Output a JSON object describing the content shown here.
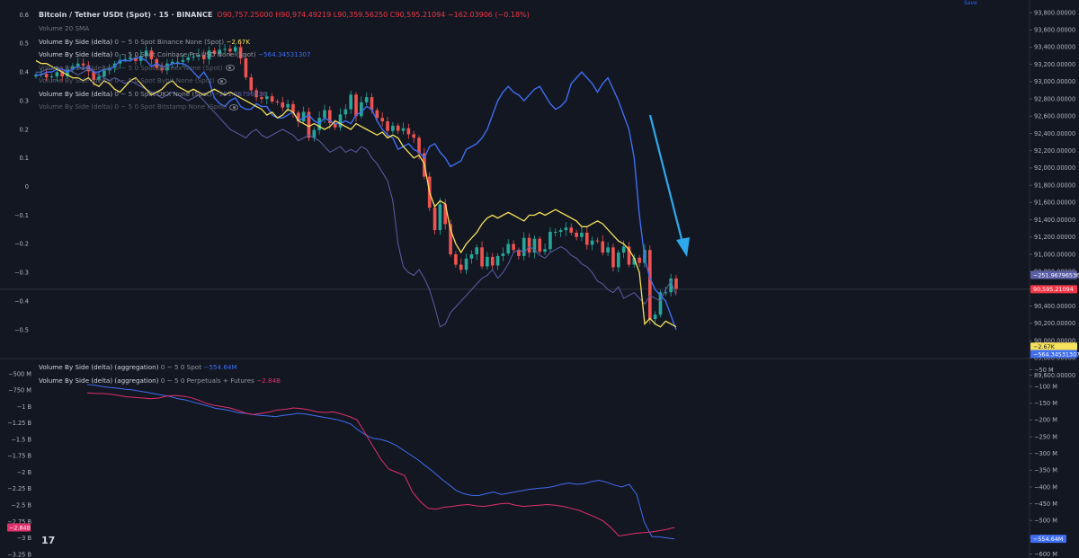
{
  "header": {
    "symbol": "Bitcoin / Tether USDt (Spot) · 15 · BINANCE",
    "ohlc": {
      "o_label": "O",
      "o": "90,757.25000",
      "h_label": "H",
      "h": "90,974.49219",
      "l_label": "L",
      "l": "90,359.56250",
      "c_label": "C",
      "c": "90,595.21094",
      "change": "−162.03906 (−0.18%)"
    },
    "top_right_tag": "Save"
  },
  "legend_top": [
    {
      "name": "Volume 20 SMA",
      "params": "",
      "value": "",
      "value_color": "#6f7482"
    },
    {
      "name": "Volume By Side (delta)",
      "params": "0 ∼ 5 0 Spot Binance None (Spot)",
      "value": "−2.67K",
      "value_color": "#f5e15b"
    },
    {
      "name": "Volume By Side (delta)",
      "params": "0 ∼ 5 0 Spot Coinbase Pro USD None (Spot)",
      "value": "−564.34531307",
      "value_color": "#3f6df0"
    },
    {
      "name": "Volume By Side (delta)",
      "params": "0 ∼ 5 0 Spot Bitfinex None (Spot)",
      "value": "",
      "value_color": "#6f7482"
    },
    {
      "name": "Volume By Side (delta)",
      "params": "0 ∼ 5 0 Spot Bybit None (Spot)",
      "value": "",
      "value_color": "#6f7482"
    },
    {
      "name": "Volume By Side (delta)",
      "params": "0 ∼ 5 0 Spot OKX None (Spot)",
      "value": "−251.96796536",
      "value_color": "#5a5fa8"
    },
    {
      "name": "Volume By Side (delta)",
      "params": "0 ∼ 5 0 Spot Bitstamp None (Spot)",
      "value": "",
      "value_color": "#6f7482"
    }
  ],
  "legend_bottom": [
    {
      "name": "Volume By Side (delta) (aggregation)",
      "params": "0 ∼ 5 0 Spot",
      "value": "−554.64M",
      "value_color": "#3f6df0"
    },
    {
      "name": "Volume By Side (delta) (aggregation)",
      "params": "0 ∼ 5 0 Perpetuals + Futures",
      "value": "−2.84B",
      "value_color": "#e0306a"
    }
  ],
  "colors": {
    "background": "#131722",
    "up": "#26a69a",
    "down": "#ef5350",
    "binance": "#f5e15b",
    "coinbase": "#3f6df0",
    "okx": "#5a5fa8",
    "spot_agg": "#3f6df0",
    "perp_agg": "#e0306a",
    "arrow": "#2fa8ee"
  },
  "price_tags": [
    {
      "text": "−251.96796536",
      "bg": "#5a5fa8",
      "fg": "#ffffff",
      "value": 90760
    },
    {
      "text": "90,595.21094",
      "bg": "#f23645",
      "fg": "#ffffff",
      "value": 90595
    },
    {
      "text": "−2.67K",
      "bg": "#f5e15b",
      "fg": "#131722",
      "value": 89930
    },
    {
      "text": "−564.34531307",
      "bg": "#3f6df0",
      "fg": "#ffffff",
      "value": 89845
    }
  ],
  "bottom_tags": {
    "left": {
      "text": "−2.84B",
      "bg": "#e0306a",
      "fg": "#ffffff",
      "value": -2.84
    },
    "right": {
      "text": "−554.64M",
      "bg": "#3f6df0",
      "fg": "#ffffff",
      "value": -554.64
    }
  },
  "tv_logo": "17",
  "chart_data": [
    {
      "type": "candlestick",
      "title": "Bitcoin / Tether USDt (Spot) · 15 · BINANCE",
      "right_axis": {
        "ticks": [
          "93,800.00000",
          "93,600.00000",
          "93,400.00000",
          "93,200.00000",
          "93,000.00000",
          "92,800.00000",
          "92,600.00000",
          "92,400.00000",
          "92,200.00000",
          "92,000.00000",
          "91,800.00000",
          "91,600.00000",
          "91,400.00000",
          "91,200.00000",
          "91,000.00000",
          "90,800.00000",
          "90,600.00000",
          "90,400.00000",
          "90,200.00000",
          "90,000.00000",
          "89,800.00000",
          "89,600.00000"
        ],
        "ylim": [
          89600,
          93800
        ]
      },
      "left_axis": {
        "ticks": [
          "0.6",
          "0.5",
          "0.4",
          "0.3",
          "0.2",
          "0.1",
          "0",
          "−0.1",
          "−0.2",
          "−0.3",
          "−0.4",
          "−0.5"
        ],
        "ylim": [
          -0.5,
          0.6
        ]
      },
      "price_closes": [
        93080,
        93090,
        93050,
        93060,
        93110,
        93060,
        93140,
        93180,
        93210,
        93190,
        93120,
        93020,
        93060,
        93130,
        93160,
        93210,
        93250,
        93260,
        93280,
        93240,
        93300,
        93360,
        93260,
        93160,
        93130,
        93210,
        93230,
        93230,
        93250,
        93280,
        93290,
        93310,
        93260,
        93360,
        93320,
        93370,
        93380,
        93350,
        93400,
        93270,
        93050,
        92900,
        92820,
        92800,
        92830,
        92770,
        92760,
        92700,
        92740,
        92640,
        92540,
        92650,
        92350,
        92440,
        92580,
        92670,
        92520,
        92470,
        92620,
        92680,
        92850,
        92600,
        92760,
        92820,
        92670,
        92580,
        92540,
        92430,
        92490,
        92430,
        92460,
        92390,
        92350,
        92170,
        91900,
        91540,
        91280,
        91580,
        91350,
        91000,
        90880,
        90820,
        90950,
        91000,
        91080,
        90860,
        90970,
        90870,
        90980,
        91010,
        91120,
        91050,
        90980,
        91190,
        91020,
        91180,
        91030,
        91060,
        91260,
        91260,
        91280,
        91310,
        91250,
        91200,
        91250,
        91110,
        91160,
        91150,
        91020,
        91080,
        90850,
        91020,
        91090,
        90880,
        90960,
        90900,
        91050,
        90250,
        90300,
        90560,
        90560,
        90720,
        90600
      ],
      "binance_cvd_delta": [
        0.44,
        0.43,
        0.43,
        0.42,
        0.41,
        0.4,
        0.39,
        0.38,
        0.38,
        0.37,
        0.38,
        0.36,
        0.35,
        0.37,
        0.36,
        0.34,
        0.33,
        0.35,
        0.37,
        0.38,
        0.36,
        0.34,
        0.32,
        0.33,
        0.34,
        0.36,
        0.37,
        0.35,
        0.34,
        0.33,
        0.34,
        0.33,
        0.32,
        0.33,
        0.34,
        0.33,
        0.32,
        0.33,
        0.32,
        0.31,
        0.3,
        0.29,
        0.28,
        0.27,
        0.25,
        0.26,
        0.24,
        0.25,
        0.27,
        0.26,
        0.23,
        0.22,
        0.21,
        0.22,
        0.21,
        0.2,
        0.21,
        0.23,
        0.22,
        0.21,
        0.2,
        0.22,
        0.21,
        0.2,
        0.19,
        0.18,
        0.19,
        0.17,
        0.18,
        0.17,
        0.14,
        0.12,
        0.1,
        0.11,
        0.08,
        -0.02,
        -0.07,
        -0.05,
        -0.06,
        -0.15,
        -0.2,
        -0.23,
        -0.2,
        -0.18,
        -0.16,
        -0.13,
        -0.11,
        -0.1,
        -0.11,
        -0.1,
        -0.09,
        -0.1,
        -0.11,
        -0.12,
        -0.1,
        -0.1,
        -0.09,
        -0.1,
        -0.09,
        -0.08,
        -0.09,
        -0.1,
        -0.11,
        -0.12,
        -0.14,
        -0.14,
        -0.13,
        -0.12,
        -0.13,
        -0.15,
        -0.17,
        -0.19,
        -0.2,
        -0.22,
        -0.25,
        -0.3,
        -0.48,
        -0.46,
        -0.48,
        -0.49,
        -0.47,
        -0.48,
        -0.49
      ],
      "coinbase_cvd_delta": [
        0.39,
        0.39,
        0.4,
        0.4,
        0.41,
        0.41,
        0.4,
        0.41,
        0.42,
        0.41,
        0.42,
        0.4,
        0.4,
        0.41,
        0.41,
        0.42,
        0.44,
        0.44,
        0.44,
        0.45,
        0.45,
        0.44,
        0.42,
        0.43,
        0.42,
        0.42,
        0.43,
        0.43,
        0.43,
        0.42,
        0.4,
        0.38,
        0.4,
        0.37,
        0.31,
        0.29,
        0.28,
        0.3,
        0.31,
        0.28,
        0.27,
        0.27,
        0.29,
        0.28,
        0.28,
        0.25,
        0.24,
        0.24,
        0.25,
        0.26,
        0.23,
        0.24,
        0.25,
        0.23,
        0.22,
        0.24,
        0.23,
        0.22,
        0.22,
        0.23,
        0.22,
        0.25,
        0.26,
        0.28,
        0.27,
        0.23,
        0.2,
        0.18,
        0.17,
        0.13,
        0.14,
        0.15,
        0.13,
        0.12,
        0.1,
        0.14,
        0.15,
        0.12,
        0.1,
        0.07,
        0.08,
        0.09,
        0.13,
        0.14,
        0.15,
        0.17,
        0.2,
        0.25,
        0.3,
        0.33,
        0.35,
        0.33,
        0.32,
        0.3,
        0.32,
        0.34,
        0.35,
        0.32,
        0.29,
        0.27,
        0.28,
        0.3,
        0.36,
        0.38,
        0.4,
        0.38,
        0.36,
        0.33,
        0.36,
        0.38,
        0.34,
        0.3,
        0.25,
        0.2,
        0.1,
        -0.1,
        -0.25,
        -0.32,
        -0.36,
        -0.38,
        -0.4,
        -0.45,
        -0.5
      ],
      "okx_cvd_delta": [
        0.4,
        0.4,
        0.41,
        0.41,
        0.42,
        0.4,
        0.41,
        0.4,
        0.39,
        0.4,
        0.41,
        0.4,
        0.39,
        0.38,
        0.37,
        0.38,
        0.37,
        0.36,
        0.37,
        0.36,
        0.35,
        0.34,
        0.33,
        0.32,
        0.31,
        0.32,
        0.33,
        0.32,
        0.31,
        0.3,
        0.31,
        0.32,
        0.3,
        0.28,
        0.26,
        0.24,
        0.22,
        0.2,
        0.19,
        0.18,
        0.17,
        0.19,
        0.2,
        0.18,
        0.17,
        0.18,
        0.19,
        0.2,
        0.19,
        0.18,
        0.16,
        0.17,
        0.18,
        0.17,
        0.16,
        0.14,
        0.12,
        0.13,
        0.14,
        0.12,
        0.13,
        0.12,
        0.14,
        0.13,
        0.1,
        0.08,
        0.05,
        0.02,
        -0.05,
        -0.2,
        -0.28,
        -0.3,
        -0.31,
        -0.29,
        -0.32,
        -0.36,
        -0.42,
        -0.49,
        -0.48,
        -0.44,
        -0.42,
        -0.4,
        -0.38,
        -0.36,
        -0.34,
        -0.32,
        -0.31,
        -0.29,
        -0.32,
        -0.3,
        -0.27,
        -0.23,
        -0.22,
        -0.23,
        -0.21,
        -0.22,
        -0.24,
        -0.25,
        -0.23,
        -0.22,
        -0.21,
        -0.22,
        -0.24,
        -0.25,
        -0.27,
        -0.28,
        -0.3,
        -0.33,
        -0.34,
        -0.36,
        -0.37,
        -0.35,
        -0.39,
        -0.38,
        -0.37,
        -0.39,
        -0.41,
        -0.38,
        -0.39,
        -0.4,
        -0.36,
        -0.33,
        -0.38
      ]
    },
    {
      "type": "line",
      "title": "Volume By Side (delta) (aggregation)",
      "left_axis": {
        "ticks": [
          "−500 M",
          "−750 M",
          "−1 B",
          "−1.25 B",
          "−1.5 B",
          "−1.75 B",
          "−2 B",
          "−2.25 B",
          "−2.5 B",
          "−2.75 B",
          "−3 B",
          "−3.25 B"
        ],
        "ylim": [
          -3.25,
          -0.5
        ]
      },
      "right_axis": {
        "ticks": [
          "−50 M",
          "−100 M",
          "−150 M",
          "−200 M",
          "−250 M",
          "−300 M",
          "−350 M",
          "−400 M",
          "−450 M",
          "−500 M",
          "−550 M",
          "−600 M"
        ],
        "ylim": [
          -600,
          -50
        ]
      },
      "series": [
        {
          "name": "0 ∼ 5 0 Spot",
          "axis": "right",
          "values": [
            -94,
            -96,
            -100,
            -103,
            -105,
            -108,
            -110,
            -114,
            -118,
            -122,
            -126,
            -130,
            -136,
            -140,
            -146,
            -152,
            -158,
            -165,
            -168,
            -172,
            -178,
            -180,
            -184,
            -186,
            -188,
            -190,
            -186,
            -184,
            -180,
            -182,
            -186,
            -190,
            -194,
            -198,
            -204,
            -212,
            -230,
            -245,
            -255,
            -258,
            -265,
            -275,
            -290,
            -305,
            -320,
            -338,
            -355,
            -375,
            -392,
            -410,
            -420,
            -425,
            -426,
            -420,
            -415,
            -422,
            -418,
            -414,
            -410,
            -406,
            -404,
            -402,
            -398,
            -392,
            -388,
            -392,
            -390,
            -384,
            -380,
            -386,
            -394,
            -400,
            -392,
            -422,
            -505,
            -548,
            -549,
            -552,
            -555
          ]
        },
        {
          "name": "0 ∼ 5 0 Perpetuals + Futures",
          "axis": "left",
          "values": [
            -0.79,
            -0.8,
            -0.8,
            -0.81,
            -0.83,
            -0.85,
            -0.86,
            -0.87,
            -0.88,
            -0.87,
            -0.84,
            -0.83,
            -0.84,
            -0.86,
            -0.9,
            -0.95,
            -0.98,
            -1.0,
            -1.02,
            -1.06,
            -1.1,
            -1.12,
            -1.1,
            -1.08,
            -1.05,
            -1.04,
            -1.02,
            -1.03,
            -1.05,
            -1.08,
            -1.09,
            -1.08,
            -1.11,
            -1.15,
            -1.2,
            -1.4,
            -1.6,
            -1.8,
            -1.95,
            -2.0,
            -2.05,
            -2.3,
            -2.45,
            -2.55,
            -2.56,
            -2.53,
            -2.52,
            -2.5,
            -2.49,
            -2.51,
            -2.52,
            -2.5,
            -2.48,
            -2.47,
            -2.5,
            -2.52,
            -2.51,
            -2.5,
            -2.49,
            -2.5,
            -2.52,
            -2.55,
            -2.58,
            -2.63,
            -2.68,
            -2.74,
            -2.84,
            -2.97,
            -2.95,
            -2.93,
            -2.92,
            -2.91,
            -2.89,
            -2.87,
            -2.84
          ]
        }
      ]
    }
  ]
}
